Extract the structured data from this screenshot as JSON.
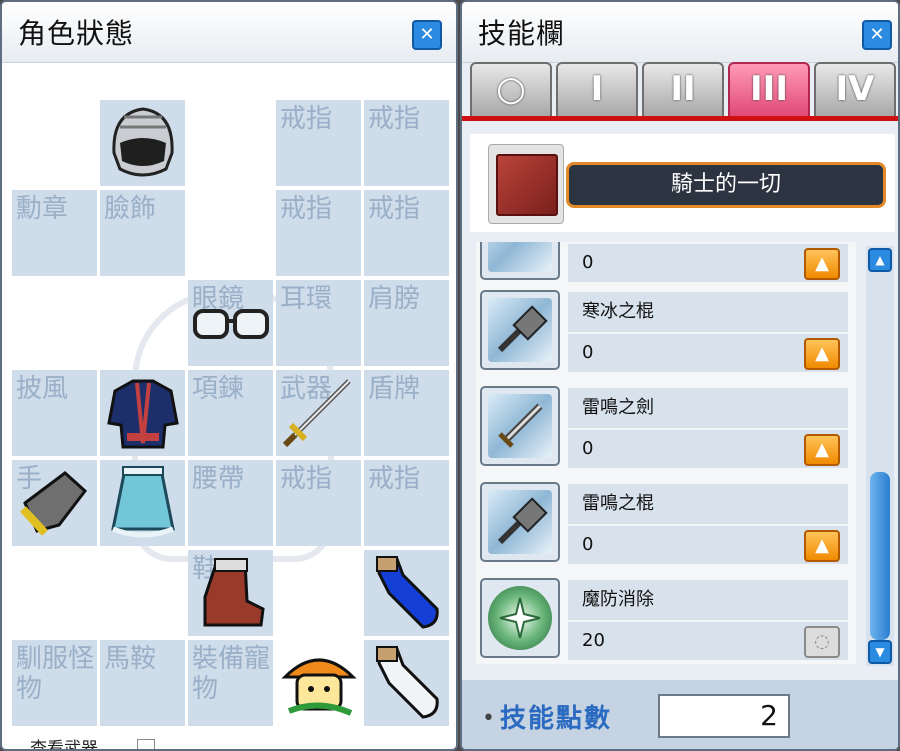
{
  "equip_window": {
    "title": "角色狀態",
    "close_icon": "close-icon",
    "slots": {
      "medal": "勳章",
      "face": "臉飾",
      "eye": "眼鏡",
      "earring": "耳環",
      "shoulder": "肩膀",
      "cape": "披風",
      "necklace": "項鍊",
      "weapon": "武器",
      "shield": "盾牌",
      "glove": "手",
      "belt": "腰帶",
      "ring": "戒指",
      "mount": "馴服怪物",
      "saddle": "馬鞍",
      "pet_equip": "裝備寵物",
      "shoe": "鞋"
    },
    "footer_label": "查看武器"
  },
  "skill_window": {
    "title": "技能欄",
    "tabs": [
      "○",
      "I",
      "II",
      "III",
      "IV"
    ],
    "active_tab": 3,
    "job_name": "騎士的一切",
    "skills": [
      {
        "name": "",
        "level": "0",
        "icon": "skill-icon"
      },
      {
        "name": "寒冰之棍",
        "level": "0",
        "icon": "ice-mace-icon"
      },
      {
        "name": "雷鳴之劍",
        "level": "0",
        "icon": "thunder-sword-icon"
      },
      {
        "name": "雷鳴之棍",
        "level": "0",
        "icon": "thunder-mace-icon"
      },
      {
        "name": "魔防消除",
        "level": "20",
        "icon": "magic-crash-icon"
      }
    ],
    "sp_label": "技能點數",
    "sp_value": "2"
  },
  "colors": {
    "accent": "#2a8be0",
    "active_tab": "#e04a78",
    "level_up": "#f08a00"
  }
}
